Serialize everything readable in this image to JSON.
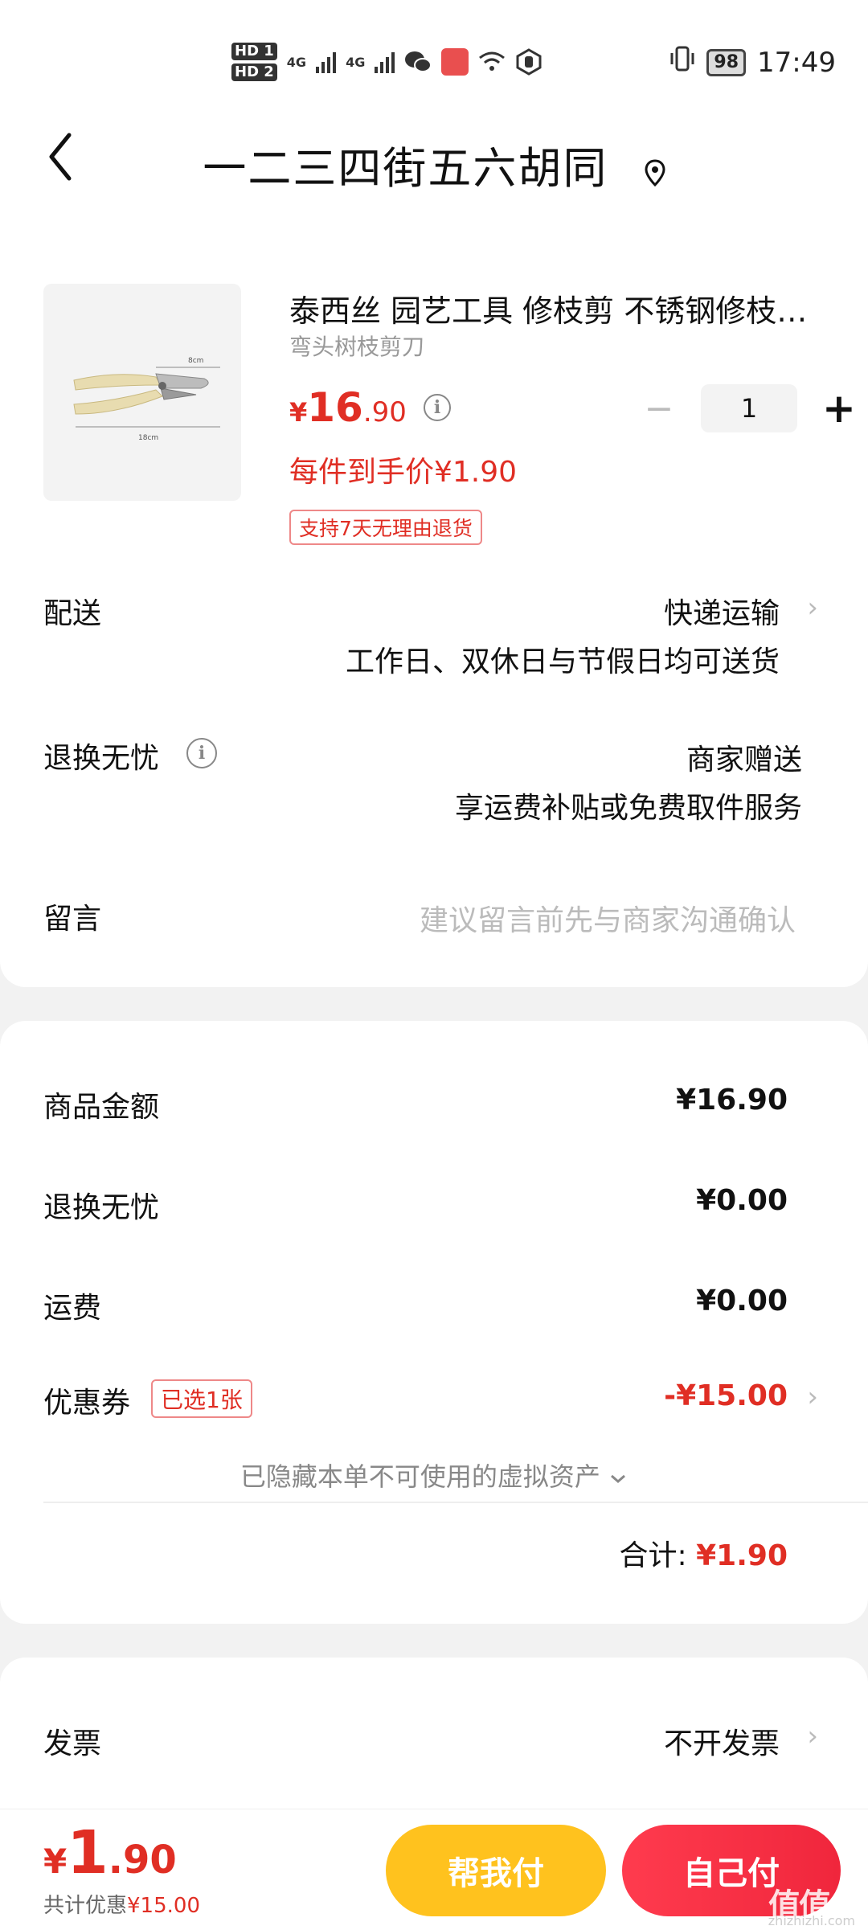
{
  "status_bar": {
    "hd1": "HD 1",
    "hd2": "HD 2",
    "net1": "4G",
    "net2": "4G",
    "battery": "98",
    "time": "17:49"
  },
  "header": {
    "title": "一二三四街五六胡同"
  },
  "product": {
    "name": "泰西丝 园艺工具 修枝剪 不锈钢修枝…",
    "sub": "弯头树枝剪刀",
    "price_currency": "¥",
    "price_int": "16",
    "price_dec": ".90",
    "unit_price": "每件到手价¥1.90",
    "tag": "支持7天无理由退货",
    "quantity": "1",
    "image_labels": [
      "8cm",
      "18cm"
    ]
  },
  "delivery": {
    "label": "配送",
    "method": "快递运输",
    "detail": "工作日、双休日与节假日均可送货"
  },
  "return": {
    "label": "退换无忧",
    "provider": "商家赠送",
    "detail": "享运费补贴或免费取件服务"
  },
  "message": {
    "label": "留言",
    "placeholder": "建议留言前先与商家沟通确认"
  },
  "summary": {
    "goods_label": "商品金额",
    "goods_value": "¥16.90",
    "return_label": "退换无忧",
    "return_value": "¥0.00",
    "shipping_label": "运费",
    "shipping_value": "¥0.00",
    "coupon_label": "优惠券",
    "coupon_badge": "已选1张",
    "coupon_value": "-¥15.00",
    "hidden_note": "已隐藏本单不可使用的虚拟资产",
    "total_label": "合计:",
    "total_value": "¥1.90"
  },
  "invoice": {
    "label": "发票",
    "value": "不开发票"
  },
  "bottom_bar": {
    "currency": "¥",
    "price_int": "1",
    "price_dec": ".90",
    "saved_label": "共计优惠",
    "saved_value": "¥15.00",
    "help_pay": "帮我付",
    "self_pay": "自己付",
    "watermark": "值值值",
    "watermark_url": "zhizhizhi.com"
  },
  "colors": {
    "accent_red": "#e02e24",
    "help_button": "#ffc21e",
    "self_button": "#f0263c"
  }
}
